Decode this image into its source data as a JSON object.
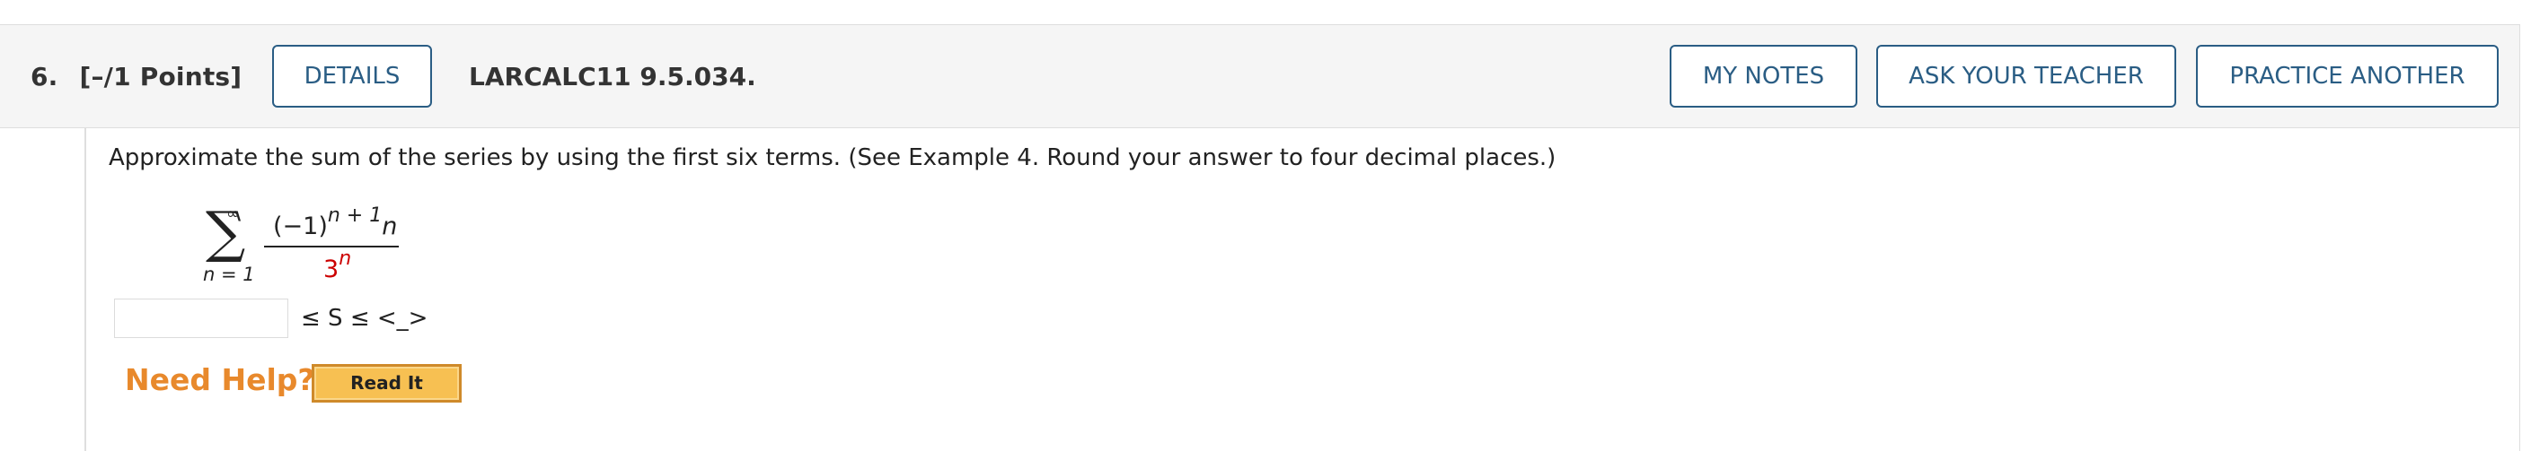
{
  "question": {
    "number": "6.",
    "points": "[–/1 Points]",
    "code": "LARCALC11 9.5.034."
  },
  "buttons": {
    "details": "DETAILS",
    "my_notes": "MY NOTES",
    "ask_teacher": "ASK YOUR TEACHER",
    "practice_another": "PRACTICE ANOTHER",
    "read_it": "Read It"
  },
  "prompt": "Approximate the sum of the series by using the first six terms. (See Example 4. Round your answer to four decimal places.)",
  "series": {
    "upper_limit": "∞",
    "sigma": "∑",
    "lower_limit": "n = 1",
    "numerator_base": "(−1)",
    "numerator_exp": "n + 1",
    "numerator_tail": "n",
    "denominator_base": "3",
    "denominator_exp": "n"
  },
  "answer": {
    "value": "",
    "inequality": "≤ S ≤ <_>"
  },
  "help": {
    "label": "Need Help?"
  },
  "colors": {
    "button_border": "#2a5d84",
    "denominator": "#cc0000",
    "need_help": "#e8892c",
    "read_it_bg": "#f7c052"
  }
}
